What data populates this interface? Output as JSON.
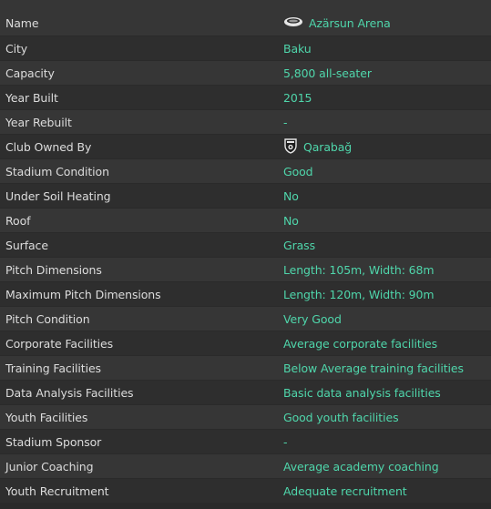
{
  "rows": [
    {
      "label": "Name",
      "value": "Azärsun Arena",
      "icon": "stadium-icon"
    },
    {
      "label": "City",
      "value": "Baku"
    },
    {
      "label": "Capacity",
      "value": "5,800 all-seater"
    },
    {
      "label": "Year Built",
      "value": "2015"
    },
    {
      "label": "Year Rebuilt",
      "value": "-"
    },
    {
      "label": "Club Owned By",
      "value": "Qarabağ",
      "icon": "club-badge-icon"
    },
    {
      "label": "Stadium Condition",
      "value": "Good"
    },
    {
      "label": "Under Soil Heating",
      "value": "No"
    },
    {
      "label": "Roof",
      "value": "No"
    },
    {
      "label": "Surface",
      "value": "Grass"
    },
    {
      "label": "Pitch Dimensions",
      "value": "Length: 105m, Width: 68m"
    },
    {
      "label": "Maximum Pitch Dimensions",
      "value": "Length: 120m, Width: 90m"
    },
    {
      "label": "Pitch Condition",
      "value": "Very Good"
    },
    {
      "label": "Corporate Facilities",
      "value": "Average corporate facilities"
    },
    {
      "label": "Training Facilities",
      "value": "Below Average training facilities"
    },
    {
      "label": "Data Analysis Facilities",
      "value": "Basic data analysis facilities"
    },
    {
      "label": "Youth Facilities",
      "value": "Good youth facilities"
    },
    {
      "label": "Stadium Sponsor",
      "value": "-"
    },
    {
      "label": "Junior Coaching",
      "value": "Average academy coaching"
    },
    {
      "label": "Youth Recruitment",
      "value": "Adequate recruitment"
    }
  ],
  "colors": {
    "value_text": "#4fd6ab",
    "label_text": "#dcdcdc",
    "row_light": "#363636",
    "row_dark": "#2e2e2e"
  }
}
